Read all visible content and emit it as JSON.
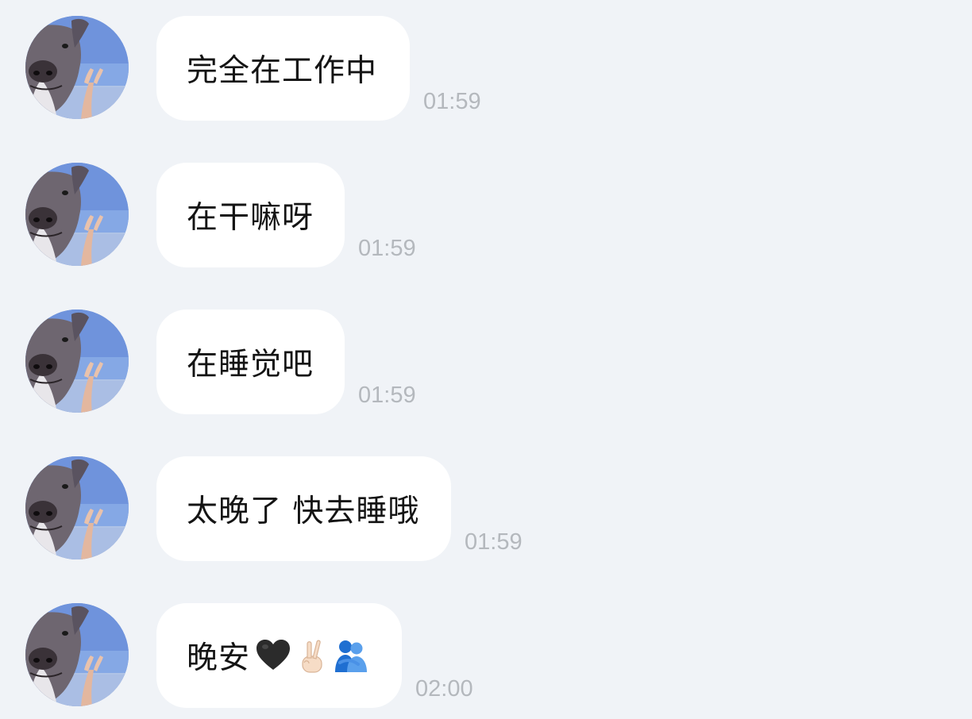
{
  "messages": [
    {
      "text": "完全在工作中",
      "time": "01:59"
    },
    {
      "text": "在干嘛呀",
      "time": "01:59"
    },
    {
      "text": "在睡觉吧",
      "time": "01:59"
    },
    {
      "text": "太晚了 快去睡哦",
      "time": "01:59"
    },
    {
      "text": "晚安",
      "time": "02:00",
      "emojis": [
        "black-heart",
        "crossed-fingers",
        "people-hugging"
      ]
    }
  ],
  "colors": {
    "background": "#f0f3f7",
    "bubble": "#ffffff",
    "text": "#141414",
    "timestamp": "#b4b8bd"
  }
}
